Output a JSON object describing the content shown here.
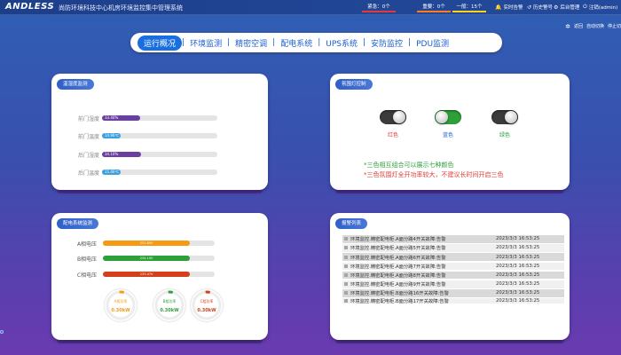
{
  "header": {
    "logo": "ANDLESS",
    "title": "尚防环境科技中心机房环境监控集中管理系统",
    "alarms": {
      "urgent": "紧急：0个",
      "important": "重要：0个",
      "normal": "一般：15个"
    },
    "nav": {
      "realtime": "实时告警",
      "history": "历史警号",
      "admin": "后台管理",
      "logout": "注销(admin)"
    }
  },
  "right_controls": {
    "back": "返回",
    "autoswitch": "自动切换",
    "stop": "停止切"
  },
  "tabs": [
    "运行概况",
    "环境监测",
    "精密空调",
    "配电系统",
    "UPS系统",
    "安防监控",
    "PDU监测"
  ],
  "temperature": {
    "title": "温湿度监测",
    "rows": [
      {
        "label": "前门湿度",
        "value": "33.40%",
        "percent": 0.33,
        "color": "#6b3fa0"
      },
      {
        "label": "前门温度",
        "value": "14.90℃",
        "percent": 0.15,
        "color": "#3aa0e0"
      },
      {
        "label": "后门湿度",
        "value": "34.10%",
        "percent": 0.34,
        "color": "#6b3fa0"
      },
      {
        "label": "后门温度",
        "value": "15.40℃",
        "percent": 0.15,
        "color": "#3aa0e0"
      }
    ]
  },
  "light": {
    "title": "氛围灯控制",
    "switches": [
      {
        "label": "红色",
        "state": "off",
        "color": "#e53935"
      },
      {
        "label": "蓝色",
        "state": "on",
        "color": "#1e5fd0"
      },
      {
        "label": "绿色",
        "state": "off",
        "color": "#2ea03a"
      }
    ],
    "note_green": "*三色相互组合可以展示七种颜色",
    "note_red": "*三色氛围灯全开功率较大，不建议长时间开启三色"
  },
  "power": {
    "title": "配电系统监测",
    "rows": [
      {
        "label": "A相电压",
        "value": "231.65V",
        "percent": 0.78,
        "color": "#f59a12"
      },
      {
        "label": "B相电压",
        "value": "234.10V",
        "percent": 0.78,
        "color": "#2ea03a"
      },
      {
        "label": "C相电压",
        "value": "233.47V",
        "percent": 0.78,
        "color": "#d3401b"
      }
    ],
    "gauges": [
      {
        "name": "A相功率",
        "value": "0.30kW",
        "color": "#f59a12"
      },
      {
        "name": "B相功率",
        "value": "0.30kW",
        "color": "#2ea03a"
      },
      {
        "name": "C相功率",
        "value": "0.30kW",
        "color": "#d3401b"
      }
    ]
  },
  "alarm_list": {
    "title": "报警列表",
    "items": [
      {
        "msg": "环境监控.精密配电柜.A面分路4开关故障:告警",
        "time": "2023/3/3  16:53:25"
      },
      {
        "msg": "环境监控.精密配电柜.A面分路5开关故障:告警",
        "time": "2023/3/3  16:53:25"
      },
      {
        "msg": "环境监控.精密配电柜.A面分路6开关故障:告警",
        "time": "2023/3/3  16:53:25"
      },
      {
        "msg": "环境监控.精密配电柜.A面分路7开关故障:告警",
        "time": "2023/3/3  16:53:25"
      },
      {
        "msg": "环境监控.精密配电柜.A面分路8开关故障:告警",
        "time": "2023/3/3  16:53:25"
      },
      {
        "msg": "环境监控.精密配电柜.A面分路9开关故障:告警",
        "time": "2023/3/3  16:53:25"
      },
      {
        "msg": "环境监控.精密配电柜.B面分路16开关故障:告警",
        "time": "2023/3/3  16:53:25"
      },
      {
        "msg": "环境监控.精密配电柜.B面分路17开关故障:告警",
        "time": "2023/3/3  16:53:25"
      }
    ]
  }
}
